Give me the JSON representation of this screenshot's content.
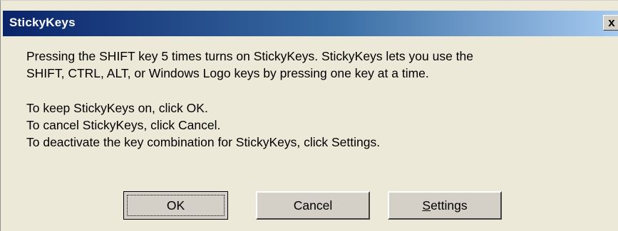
{
  "window": {
    "title": "StickyKeys",
    "close_label": "x"
  },
  "message": {
    "line1": "Pressing the SHIFT key 5 times turns on StickyKeys. StickyKeys lets you use the",
    "line2": "SHIFT, CTRL, ALT, or Windows Logo keys by pressing one key at a time.",
    "line3": "To keep StickyKeys on, click OK.",
    "line4": "To cancel StickyKeys, click Cancel.",
    "line5": "To deactivate the key combination for StickyKeys, click Settings."
  },
  "buttons": {
    "ok_label": "OK",
    "cancel_label": "Cancel",
    "settings_accel": "S",
    "settings_rest": "ettings"
  }
}
